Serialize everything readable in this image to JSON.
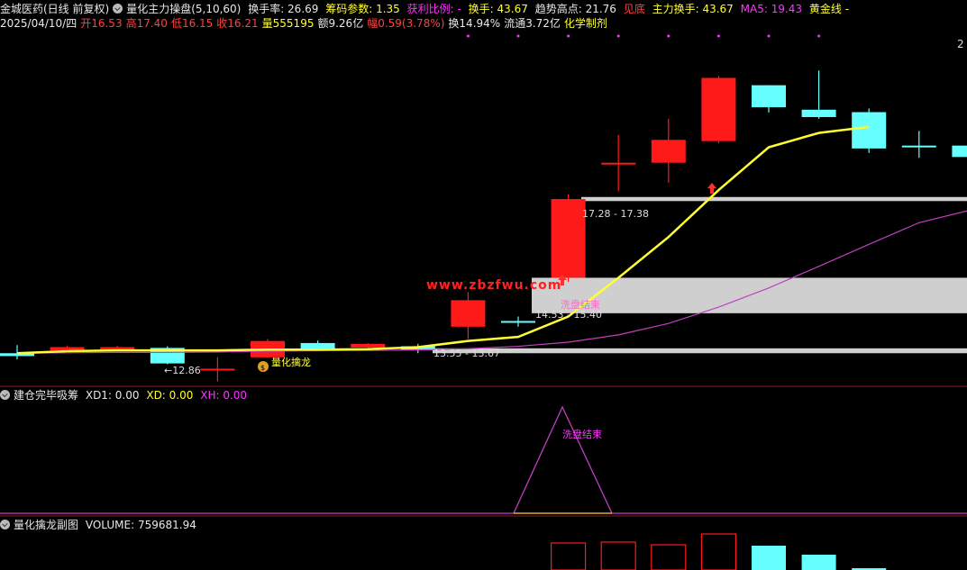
{
  "header": {
    "stock_name": "金城医药(日线 前复权)",
    "indicator": "量化主力操盘(5,10,60)",
    "turnover_rate": "换手率: 26.69",
    "chip_param": "筹码参数: 1.35",
    "profit_ratio": "获利比例: -",
    "turnover": "换手: 43.67",
    "trend_high": "趋势高点: 21.76",
    "bottom": "见底",
    "main_turnover": "主力换手: 43.67",
    "ma5": "MA5: 19.43",
    "golden_line": "黄金线 -",
    "right_mark": "2"
  },
  "info": {
    "date": "2025/04/10/四",
    "open": "开16.53",
    "high": "高17.40",
    "low": "低16.15",
    "close": "收16.21",
    "volume": "量555195",
    "amount": "额9.26亿",
    "amplitude": "幅0.59(3.78%)",
    "turnover": "换14.94%",
    "float": "流通3.72亿",
    "sector": "化学制剂"
  },
  "main_chart": {
    "labels": {
      "low_mark": "←12.86",
      "zone_top": "17.28 - 17.38",
      "zone_mid": "14.53 - 15.40",
      "zone_low": "13.55 - 13.67",
      "wash_end": "洗盘结束",
      "qinglong": "量化擒龙",
      "watermark": "www.zbzfwu.com"
    }
  },
  "panel2": {
    "title": "建仓完毕吸筹",
    "xd1": "XD1: 0.00",
    "xd": "XD: 0.00",
    "xh": "XH: 0.00",
    "wash_end": "洗盘结束"
  },
  "panel3": {
    "title": "量化擒龙副图",
    "volume": "VOLUME: 759681.94"
  },
  "colors": {
    "up": "#ff1a1a",
    "down": "#66ffff",
    "ma_yellow": "#ffff33",
    "ma_purple": "#c040c0",
    "zone": "#cfcfcf"
  },
  "chart_data": {
    "type": "candlestick",
    "candles": [
      {
        "o": 13.55,
        "c": 13.48,
        "h": 13.75,
        "l": 13.4,
        "dir": "down"
      },
      {
        "o": 13.62,
        "c": 13.7,
        "h": 13.74,
        "l": 13.58,
        "dir": "up"
      },
      {
        "o": 13.64,
        "c": 13.7,
        "h": 13.73,
        "l": 13.6,
        "dir": "up"
      },
      {
        "o": 13.68,
        "c": 13.3,
        "h": 13.72,
        "l": 13.28,
        "dir": "down"
      },
      {
        "o": 13.15,
        "c": 13.17,
        "h": 13.45,
        "l": 12.86,
        "dir": "up"
      },
      {
        "o": 13.45,
        "c": 13.85,
        "h": 13.9,
        "l": 13.44,
        "dir": "up"
      },
      {
        "o": 13.8,
        "c": 13.66,
        "h": 13.86,
        "l": 13.65,
        "dir": "down"
      },
      {
        "o": 13.69,
        "c": 13.78,
        "h": 13.8,
        "l": 13.65,
        "dir": "up"
      },
      {
        "o": 13.72,
        "c": 13.62,
        "h": 13.78,
        "l": 13.55,
        "dir": "down"
      },
      {
        "o": 14.2,
        "c": 14.85,
        "h": 15.05,
        "l": 13.9,
        "dir": "up"
      },
      {
        "o": 14.34,
        "c": 14.32,
        "h": 14.45,
        "l": 14.2,
        "dir": "down"
      },
      {
        "o": 15.4,
        "c": 17.33,
        "h": 17.45,
        "l": 15.3,
        "dir": "up"
      },
      {
        "o": 18.18,
        "c": 18.22,
        "h": 18.9,
        "l": 17.52,
        "dir": "up"
      },
      {
        "o": 18.22,
        "c": 18.78,
        "h": 19.3,
        "l": 17.73,
        "dir": "up"
      },
      {
        "o": 18.75,
        "c": 20.3,
        "h": 20.35,
        "l": 18.7,
        "dir": "up"
      },
      {
        "o": 20.12,
        "c": 19.58,
        "h": 20.12,
        "l": 19.45,
        "dir": "down"
      },
      {
        "o": 19.52,
        "c": 19.34,
        "h": 20.48,
        "l": 19.3,
        "dir": "down"
      },
      {
        "o": 19.46,
        "c": 18.57,
        "h": 19.55,
        "l": 18.46,
        "dir": "down"
      },
      {
        "o": 18.64,
        "c": 18.6,
        "h": 19.0,
        "l": 18.34,
        "dir": "down"
      },
      {
        "o": 18.64,
        "c": 18.36,
        "h": 18.88,
        "l": 18.12,
        "dir": "down"
      }
    ],
    "ma_yellow": [
      13.55,
      13.6,
      13.62,
      13.62,
      13.62,
      13.64,
      13.64,
      13.65,
      13.7,
      13.85,
      13.95,
      14.45,
      15.4,
      16.4,
      17.55,
      18.6,
      18.95,
      19.1,
      null,
      null
    ],
    "ma_purple": [
      13.55,
      13.56,
      13.57,
      13.57,
      13.58,
      13.6,
      13.61,
      13.62,
      13.63,
      13.66,
      13.72,
      13.82,
      14.0,
      14.28,
      14.68,
      15.15,
      15.68,
      16.22,
      16.75,
      17.05
    ],
    "zones": [
      {
        "low": 17.28,
        "high": 17.38
      },
      {
        "low": 14.53,
        "high": 15.4
      },
      {
        "low": 13.55,
        "high": 13.67
      }
    ],
    "volume_up_bars": [
      11,
      12,
      13,
      14
    ],
    "volume_down_bars": [
      15,
      16,
      17
    ]
  }
}
